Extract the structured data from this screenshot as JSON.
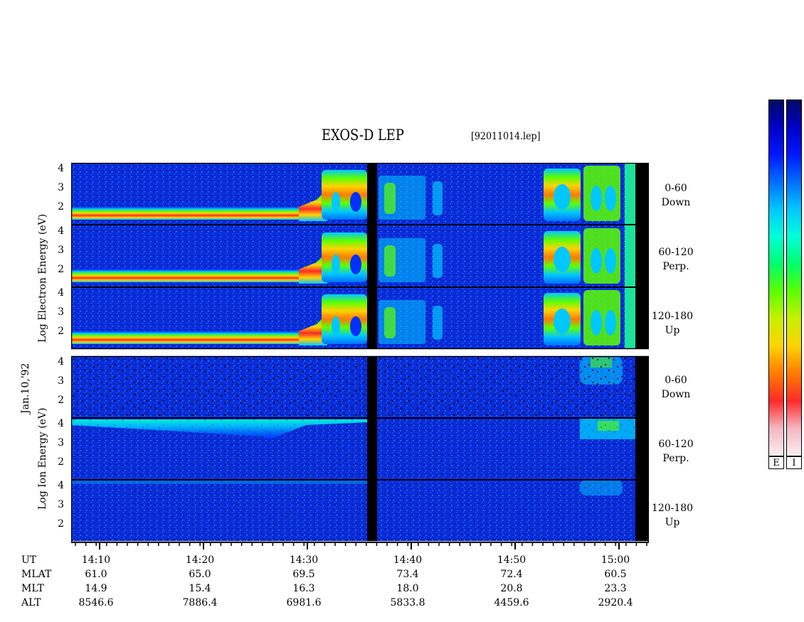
{
  "header": {
    "title": "EXOS-D LEP",
    "file": "[92011014.lep]"
  },
  "left_label": "Jan.10,'92",
  "groups": [
    {
      "id": "electron",
      "ylabel": "Log   Electron   Energy (eV)",
      "panels": [
        {
          "angle": "0-60",
          "dir": "Down"
        },
        {
          "angle": "60-120",
          "dir": "Perp."
        },
        {
          "angle": "120-180",
          "dir": "Up"
        }
      ]
    },
    {
      "id": "ion",
      "ylabel": "Log   Ion   Energy (eV)",
      "panels": [
        {
          "angle": "0-60",
          "dir": "Down"
        },
        {
          "angle": "60-120",
          "dir": "Perp."
        },
        {
          "angle": "120-180",
          "dir": "Up"
        }
      ]
    }
  ],
  "yticks": [
    "4",
    "3",
    "2"
  ],
  "colorbar": {
    "labels": [
      "E",
      "I"
    ],
    "stops": [
      "#fbeef2",
      "#f4b6c2",
      "#ff2a2a",
      "#ff7a00",
      "#ffd200",
      "#c8f000",
      "#5cff00",
      "#00ff6a",
      "#00ffd8",
      "#00c8ff",
      "#0070ff",
      "#0018ff",
      "#0000c8",
      "#000a64"
    ]
  },
  "footer": {
    "row_labels": [
      "UT",
      "MLAT",
      "MLT",
      "ALT"
    ],
    "columns": [
      {
        "ut": "14:10",
        "mlat": "61.0",
        "mlt": "14.9",
        "alt": "8546.6"
      },
      {
        "ut": "14:20",
        "mlat": "65.0",
        "mlt": "15.4",
        "alt": "7886.4"
      },
      {
        "ut": "14:30",
        "mlat": "69.5",
        "mlt": "16.3",
        "alt": "6981.6"
      },
      {
        "ut": "14:40",
        "mlat": "73.4",
        "mlt": "18.0",
        "alt": "5833.8"
      },
      {
        "ut": "14:50",
        "mlat": "72.4",
        "mlt": "20.8",
        "alt": "4459.6"
      },
      {
        "ut": "15:00",
        "mlat": "60.5",
        "mlt": "23.3",
        "alt": "2920.4"
      }
    ]
  },
  "chart_data": {
    "type": "heatmap",
    "title": "EXOS-D LEP",
    "xlabel": "UT",
    "x_ticks": [
      "14:10",
      "14:20",
      "14:30",
      "14:40",
      "14:50",
      "15:00"
    ],
    "y_scale": "log",
    "y_ticks": [
      4,
      3,
      2
    ],
    "ylabel_electron": "Log Electron Energy (eV)",
    "ylabel_ion": "Log Ion Energy (eV)",
    "panels": [
      "0-60 Down",
      "60-120 Perp.",
      "120-180 Up"
    ],
    "legend": "right (E / I color bars)"
  }
}
